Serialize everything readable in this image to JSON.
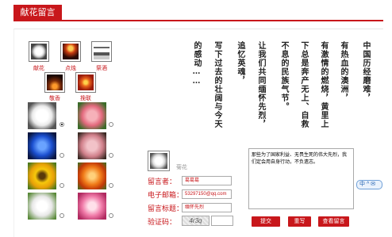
{
  "header": {
    "tab_label": "献花留言"
  },
  "offerings": [
    {
      "label": "献花",
      "icon": "flower-icon"
    },
    {
      "label": "点烛",
      "icon": "candle-icon"
    },
    {
      "label": "祭酒",
      "icon": "wine-icon"
    },
    {
      "label": "敬香",
      "icon": "incense-icon"
    },
    {
      "label": "挽联",
      "icon": "couplet-icon"
    }
  ],
  "flowers": {
    "selected_index": 0,
    "count": 10
  },
  "poem": {
    "columns": [
      "中国历经磨难，",
      "有热血的澳洲，",
      "有激情的燃烧，黄里上",
      "下总是奔产无上、自救",
      "不息的民族气节。",
      "让我们共同缅怀先烈，",
      "追忆英魂，",
      "写下过去的壮阔与今天",
      "的感动……"
    ]
  },
  "selected_flower": {
    "name": "菊花"
  },
  "form": {
    "name_label": "留言者：",
    "name_value": "葛葛葛",
    "email_label": "电子邮箱：",
    "email_value": "53297150@qq.com",
    "title_label": "留言标题：",
    "title_value": "缅怀先烈",
    "captcha_label": "验证码：",
    "captcha_value": "4r3q"
  },
  "message": {
    "text": "那些为了国家利益、无畏生死的伟大先烈，我们定会用自身行动，不负遗志。"
  },
  "buttons": {
    "submit": "提交",
    "rewrite": "重写",
    "view": "查看留言"
  },
  "side_widget": {
    "label": "中 ^ ✉"
  }
}
